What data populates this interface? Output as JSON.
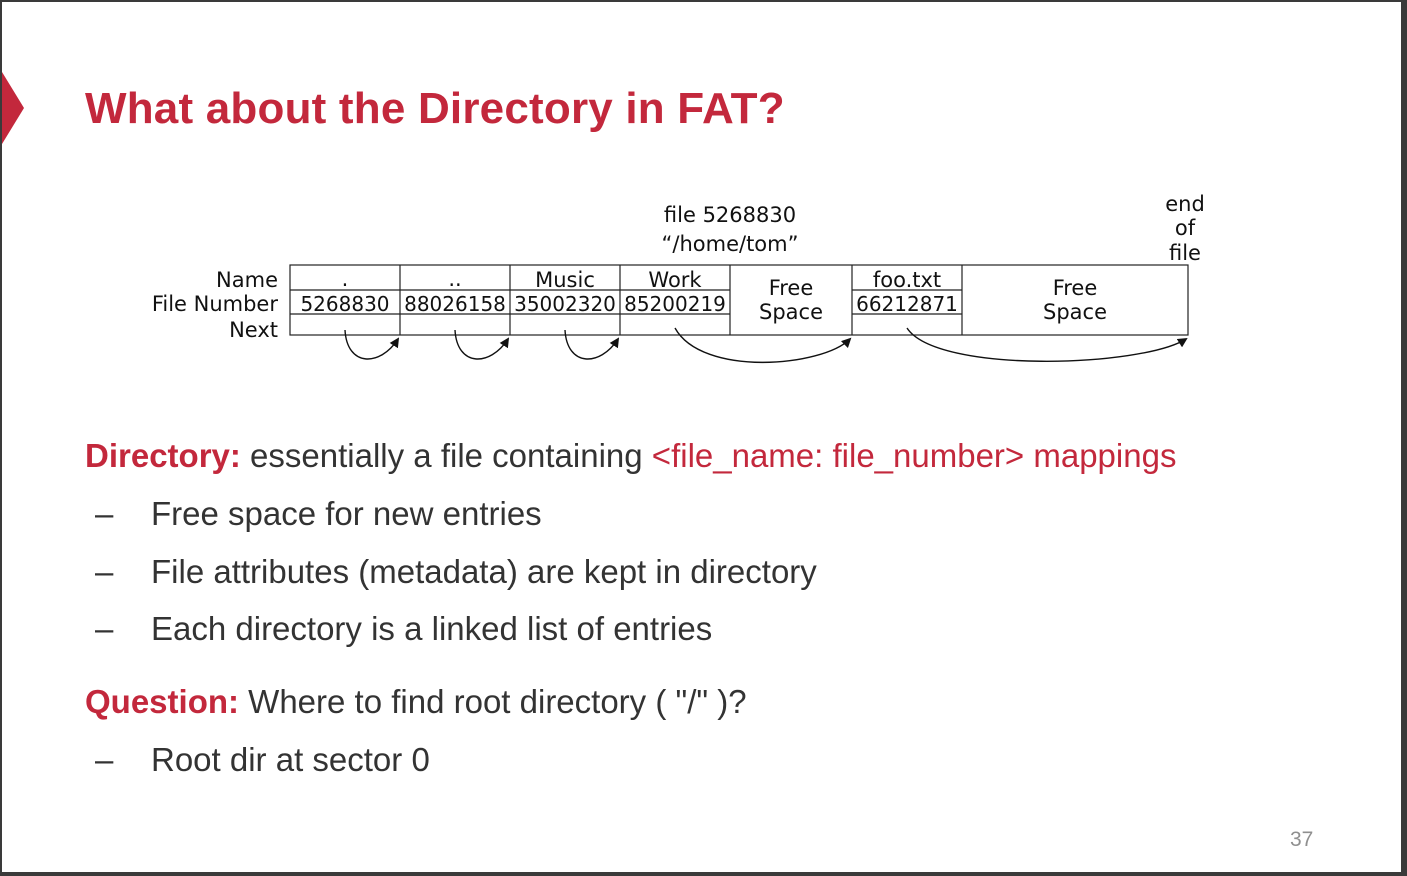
{
  "slide": {
    "title": "What about the Directory in FAT?",
    "page_number": "37",
    "accent_color": "#c3283c"
  },
  "diagram": {
    "row_labels": [
      "Name",
      "File Number",
      "Next"
    ],
    "top_label_line1": "file 5268830",
    "top_label_line2": "“/home/tom”",
    "end_label": [
      "end",
      "of",
      "file"
    ],
    "entries": [
      {
        "name": ".",
        "number": "5268830"
      },
      {
        "name": "..",
        "number": "88026158"
      },
      {
        "name": "Music",
        "number": "35002320"
      },
      {
        "name": "Work",
        "number": "85200219"
      },
      {
        "free": [
          "Free",
          "Space"
        ]
      },
      {
        "name": "foo.txt",
        "number": "66212871"
      },
      {
        "free": [
          "Free",
          "Space"
        ]
      }
    ]
  },
  "bullets": {
    "directory_lead": "Directory:",
    "directory_text": " essentially a file containing ",
    "directory_highlight": "<file_name: file_number> mappings",
    "dir_items": [
      "Free space for new entries",
      "File attributes (metadata) are kept in directory",
      "Each directory is a linked list of entries"
    ],
    "question_lead": "Question:",
    "question_text": " Where to find root directory ( \"/\" )?",
    "question_items": [
      "Root dir at sector 0"
    ],
    "dash": "–"
  }
}
